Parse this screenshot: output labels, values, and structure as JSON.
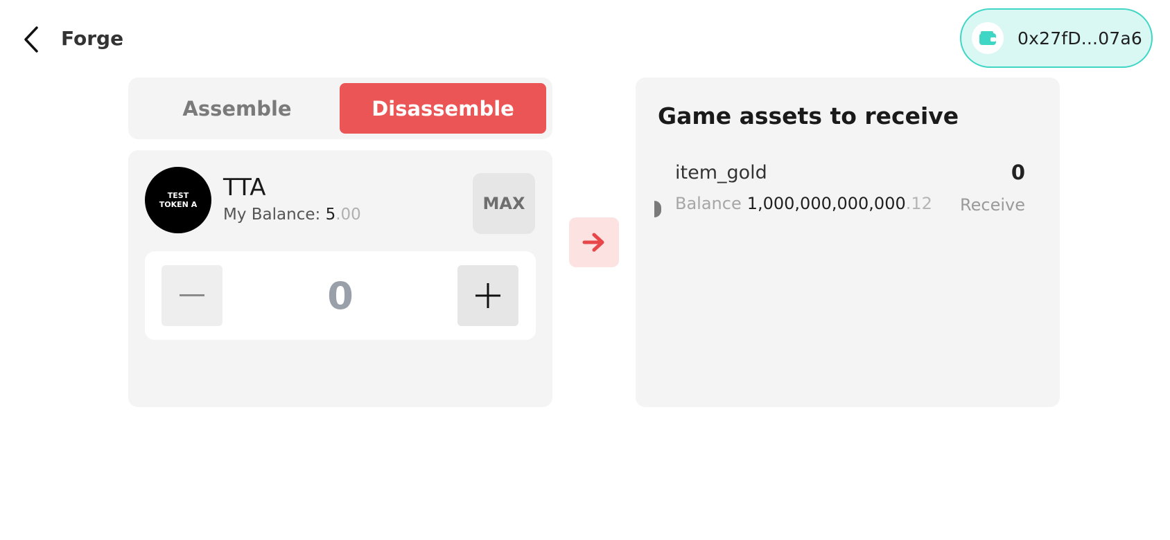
{
  "header": {
    "title": "Forge",
    "back_icon": "chevron-left-icon"
  },
  "wallet": {
    "address": "0x27fD...07a6",
    "icon": "wallet-icon",
    "accent": "#3fd6c6"
  },
  "tabs": [
    {
      "label": "Assemble",
      "active": false
    },
    {
      "label": "Disassemble",
      "active": true
    }
  ],
  "token": {
    "logo_text_line1": "TEST",
    "logo_text_line2": "TOKEN A",
    "symbol": "TTA",
    "balance_label": "My Balance: ",
    "balance_int": "5",
    "balance_dec": ".00",
    "max_label": "MAX"
  },
  "stepper": {
    "value": "0",
    "minus_icon": "minus-icon",
    "plus_icon": "plus-icon"
  },
  "arrow": {
    "icon": "arrow-right-icon",
    "color": "#e8474a"
  },
  "receive": {
    "title": "Game assets to receive",
    "items": [
      {
        "name": "item_gold",
        "amount": "0",
        "balance_label": "Balance",
        "balance_int": "1,000,000,000,000",
        "balance_dec": ".12",
        "action_label": "Receive"
      }
    ]
  },
  "colors": {
    "active_tab": "#ec5556",
    "card_bg": "#f4f4f4"
  }
}
